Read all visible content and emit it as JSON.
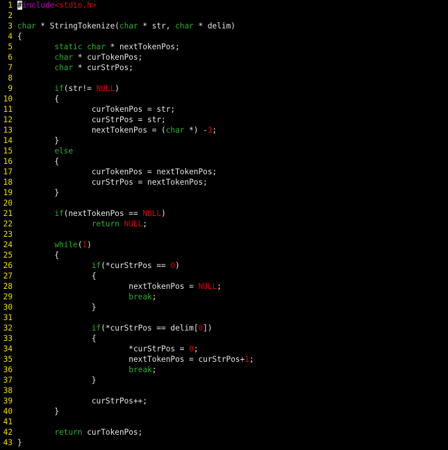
{
  "editor": {
    "colors": {
      "background": "#000000",
      "line_number": "#f0e000",
      "text": "#e6e6e6",
      "keyword": "#30b030",
      "constant": "#e00000",
      "preprocessor": "#c000c0"
    },
    "lines": [
      {
        "n": "1",
        "tokens": [
          {
            "t": "#",
            "c": "cursor"
          },
          {
            "t": "include",
            "c": "t-pre"
          },
          {
            "t": "<stdio.h>",
            "c": "t-str"
          }
        ]
      },
      {
        "n": "2",
        "tokens": []
      },
      {
        "n": "3",
        "tokens": [
          {
            "t": "char",
            "c": "t-type"
          },
          {
            "t": " * StringTokenize(",
            "c": "t-normal"
          },
          {
            "t": "char",
            "c": "t-type"
          },
          {
            "t": " * str, ",
            "c": "t-normal"
          },
          {
            "t": "char",
            "c": "t-type"
          },
          {
            "t": " * delim)",
            "c": "t-normal"
          }
        ]
      },
      {
        "n": "4",
        "tokens": [
          {
            "t": "{",
            "c": "t-normal"
          }
        ]
      },
      {
        "n": "5",
        "tokens": [
          {
            "t": "        ",
            "c": "t-normal"
          },
          {
            "t": "static",
            "c": "t-keyword"
          },
          {
            "t": " ",
            "c": "t-normal"
          },
          {
            "t": "char",
            "c": "t-type"
          },
          {
            "t": " * nextTokenPos;",
            "c": "t-normal"
          }
        ]
      },
      {
        "n": "6",
        "tokens": [
          {
            "t": "        ",
            "c": "t-normal"
          },
          {
            "t": "char",
            "c": "t-type"
          },
          {
            "t": " * curTokenPos;",
            "c": "t-normal"
          }
        ]
      },
      {
        "n": "7",
        "tokens": [
          {
            "t": "        ",
            "c": "t-normal"
          },
          {
            "t": "char",
            "c": "t-type"
          },
          {
            "t": " * curStrPos;",
            "c": "t-normal"
          }
        ]
      },
      {
        "n": "8",
        "tokens": []
      },
      {
        "n": "9",
        "tokens": [
          {
            "t": "        ",
            "c": "t-normal"
          },
          {
            "t": "if",
            "c": "t-keyword"
          },
          {
            "t": "(str!= ",
            "c": "t-normal"
          },
          {
            "t": "NULL",
            "c": "t-const"
          },
          {
            "t": ")",
            "c": "t-normal"
          }
        ]
      },
      {
        "n": "10",
        "tokens": [
          {
            "t": "        {",
            "c": "t-normal"
          }
        ]
      },
      {
        "n": "11",
        "tokens": [
          {
            "t": "                curTokenPos = str;",
            "c": "t-normal"
          }
        ]
      },
      {
        "n": "12",
        "tokens": [
          {
            "t": "                curStrPos = str;",
            "c": "t-normal"
          }
        ]
      },
      {
        "n": "13",
        "tokens": [
          {
            "t": "                nextTokenPos = (",
            "c": "t-normal"
          },
          {
            "t": "char",
            "c": "t-type"
          },
          {
            "t": " *) -",
            "c": "t-normal"
          },
          {
            "t": "1",
            "c": "t-const"
          },
          {
            "t": ";",
            "c": "t-normal"
          }
        ]
      },
      {
        "n": "14",
        "tokens": [
          {
            "t": "        }",
            "c": "t-normal"
          }
        ]
      },
      {
        "n": "15",
        "tokens": [
          {
            "t": "        ",
            "c": "t-normal"
          },
          {
            "t": "else",
            "c": "t-keyword"
          }
        ]
      },
      {
        "n": "16",
        "tokens": [
          {
            "t": "        {",
            "c": "t-normal"
          }
        ]
      },
      {
        "n": "17",
        "tokens": [
          {
            "t": "                curTokenPos = nextTokenPos;",
            "c": "t-normal"
          }
        ]
      },
      {
        "n": "18",
        "tokens": [
          {
            "t": "                curStrPos = nextTokenPos;",
            "c": "t-normal"
          }
        ]
      },
      {
        "n": "19",
        "tokens": [
          {
            "t": "        }",
            "c": "t-normal"
          }
        ]
      },
      {
        "n": "20",
        "tokens": []
      },
      {
        "n": "21",
        "tokens": [
          {
            "t": "        ",
            "c": "t-normal"
          },
          {
            "t": "if",
            "c": "t-keyword"
          },
          {
            "t": "(nextTokenPos == ",
            "c": "t-normal"
          },
          {
            "t": "NULL",
            "c": "t-const"
          },
          {
            "t": ")",
            "c": "t-normal"
          }
        ]
      },
      {
        "n": "22",
        "tokens": [
          {
            "t": "                ",
            "c": "t-normal"
          },
          {
            "t": "return",
            "c": "t-keyword"
          },
          {
            "t": " ",
            "c": "t-normal"
          },
          {
            "t": "NULL",
            "c": "t-const"
          },
          {
            "t": ";",
            "c": "t-normal"
          }
        ]
      },
      {
        "n": "23",
        "tokens": []
      },
      {
        "n": "24",
        "tokens": [
          {
            "t": "        ",
            "c": "t-normal"
          },
          {
            "t": "while",
            "c": "t-keyword"
          },
          {
            "t": "(",
            "c": "t-normal"
          },
          {
            "t": "1",
            "c": "t-const"
          },
          {
            "t": ")",
            "c": "t-normal"
          }
        ]
      },
      {
        "n": "25",
        "tokens": [
          {
            "t": "        {",
            "c": "t-normal"
          }
        ]
      },
      {
        "n": "26",
        "tokens": [
          {
            "t": "                ",
            "c": "t-normal"
          },
          {
            "t": "if",
            "c": "t-keyword"
          },
          {
            "t": "(*curStrPos == ",
            "c": "t-normal"
          },
          {
            "t": "0",
            "c": "t-const"
          },
          {
            "t": ")",
            "c": "t-normal"
          }
        ]
      },
      {
        "n": "27",
        "tokens": [
          {
            "t": "                {",
            "c": "t-normal"
          }
        ]
      },
      {
        "n": "28",
        "tokens": [
          {
            "t": "                        nextTokenPos = ",
            "c": "t-normal"
          },
          {
            "t": "NULL",
            "c": "t-const"
          },
          {
            "t": ";",
            "c": "t-normal"
          }
        ]
      },
      {
        "n": "29",
        "tokens": [
          {
            "t": "                        ",
            "c": "t-normal"
          },
          {
            "t": "break",
            "c": "t-keyword"
          },
          {
            "t": ";",
            "c": "t-normal"
          }
        ]
      },
      {
        "n": "30",
        "tokens": [
          {
            "t": "                }",
            "c": "t-normal"
          }
        ]
      },
      {
        "n": "31",
        "tokens": []
      },
      {
        "n": "32",
        "tokens": [
          {
            "t": "                ",
            "c": "t-normal"
          },
          {
            "t": "if",
            "c": "t-keyword"
          },
          {
            "t": "(*curStrPos == delim[",
            "c": "t-normal"
          },
          {
            "t": "0",
            "c": "t-const"
          },
          {
            "t": "])",
            "c": "t-normal"
          }
        ]
      },
      {
        "n": "33",
        "tokens": [
          {
            "t": "                {",
            "c": "t-normal"
          }
        ]
      },
      {
        "n": "34",
        "tokens": [
          {
            "t": "                        *curStrPos = ",
            "c": "t-normal"
          },
          {
            "t": "0",
            "c": "t-const"
          },
          {
            "t": ";",
            "c": "t-normal"
          }
        ]
      },
      {
        "n": "35",
        "tokens": [
          {
            "t": "                        nextTokenPos = curStrPos+",
            "c": "t-normal"
          },
          {
            "t": "1",
            "c": "t-const"
          },
          {
            "t": ";",
            "c": "t-normal"
          }
        ]
      },
      {
        "n": "36",
        "tokens": [
          {
            "t": "                        ",
            "c": "t-normal"
          },
          {
            "t": "break",
            "c": "t-keyword"
          },
          {
            "t": ";",
            "c": "t-normal"
          }
        ]
      },
      {
        "n": "37",
        "tokens": [
          {
            "t": "                }",
            "c": "t-normal"
          }
        ]
      },
      {
        "n": "38",
        "tokens": []
      },
      {
        "n": "39",
        "tokens": [
          {
            "t": "                curStrPos++;",
            "c": "t-normal"
          }
        ]
      },
      {
        "n": "40",
        "tokens": [
          {
            "t": "        }",
            "c": "t-normal"
          }
        ]
      },
      {
        "n": "41",
        "tokens": []
      },
      {
        "n": "42",
        "tokens": [
          {
            "t": "        ",
            "c": "t-normal"
          },
          {
            "t": "return",
            "c": "t-keyword"
          },
          {
            "t": " curTokenPos;",
            "c": "t-normal"
          }
        ]
      },
      {
        "n": "43",
        "tokens": [
          {
            "t": "}",
            "c": "t-normal"
          }
        ]
      }
    ]
  }
}
